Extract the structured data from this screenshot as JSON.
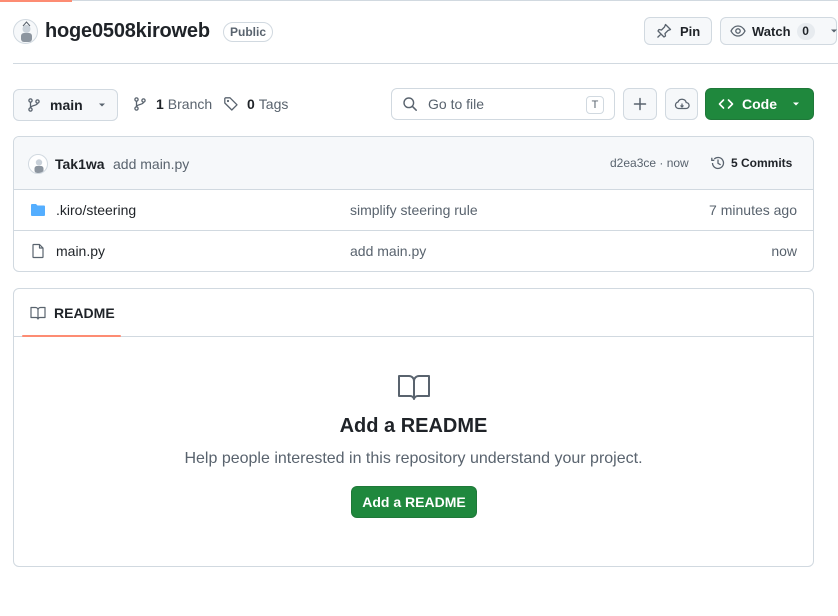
{
  "colors": {
    "accent": "#1f883d",
    "tab_underline": "#fd8c73",
    "folder": "#54aeff",
    "muted": "#59636e",
    "border": "#d1d9e0"
  },
  "header": {
    "repo_name": "hoge0508kiroweb",
    "visibility": "Public",
    "pin_label": "Pin",
    "watch_label": "Watch",
    "watch_count": "0"
  },
  "toolbar": {
    "branch": "main",
    "branch_count": "1",
    "branch_label": "Branch",
    "tag_count": "0",
    "tag_label": "Tags",
    "search_placeholder": "Go to file",
    "search_shortcut": "T",
    "code_label": "Code"
  },
  "latest_commit": {
    "author": "Tak1wa",
    "message": "add main.py",
    "sha_time": "d2ea3ce · now",
    "commits_label": "5 Commits"
  },
  "files": [
    {
      "icon": "folder-icon",
      "name": ".kiro/steering",
      "message": "simplify steering rule",
      "time": "7 minutes ago"
    },
    {
      "icon": "file-icon",
      "name": "main.py",
      "message": "add main.py",
      "time": "now"
    }
  ],
  "readme": {
    "tab_label": "README",
    "title": "Add a README",
    "description": "Help people interested in this repository understand your project.",
    "button_label": "Add a README"
  }
}
